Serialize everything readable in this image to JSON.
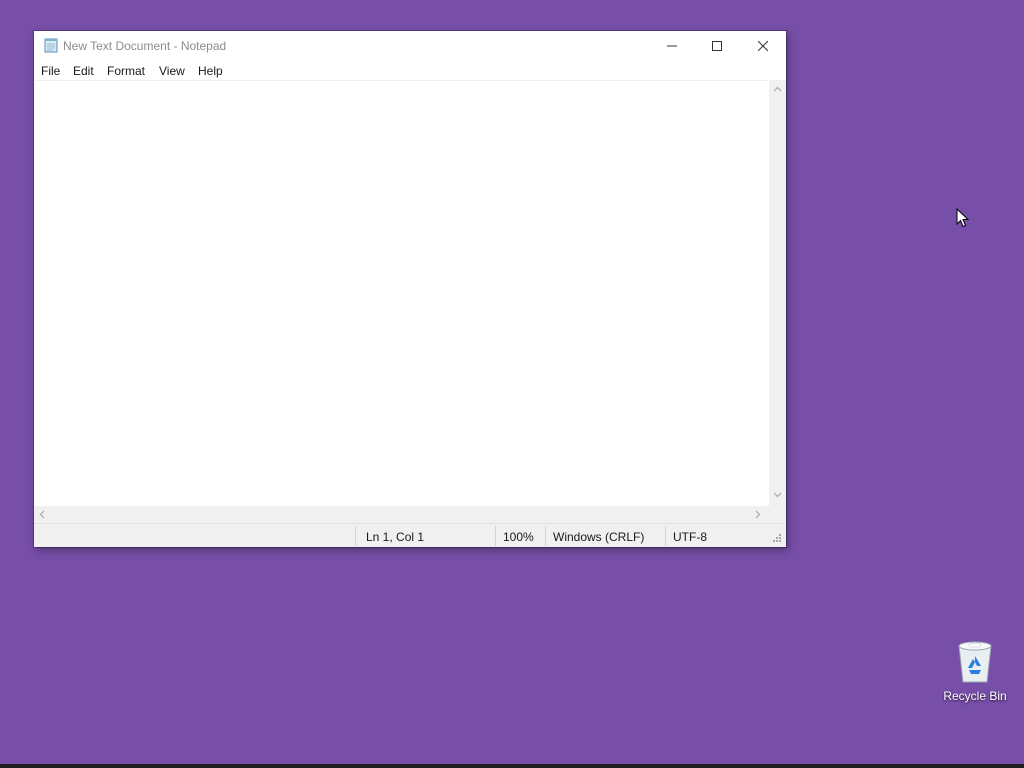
{
  "window": {
    "title": "New Text Document - Notepad",
    "icon": "notepad-icon"
  },
  "window_controls": {
    "minimize_icon": "minimize-icon",
    "maximize_icon": "maximize-icon",
    "close_icon": "close-icon"
  },
  "menu": {
    "items": [
      {
        "label": "File"
      },
      {
        "label": "Edit"
      },
      {
        "label": "Format"
      },
      {
        "label": "View"
      },
      {
        "label": "Help"
      }
    ]
  },
  "editor": {
    "content": ""
  },
  "statusbar": {
    "position": "Ln 1, Col 1",
    "zoom": "100%",
    "line_ending": "Windows (CRLF)",
    "encoding": "UTF-8"
  },
  "desktop": {
    "background_color": "#774ea8",
    "recycle_bin_label": "Recycle Bin"
  }
}
